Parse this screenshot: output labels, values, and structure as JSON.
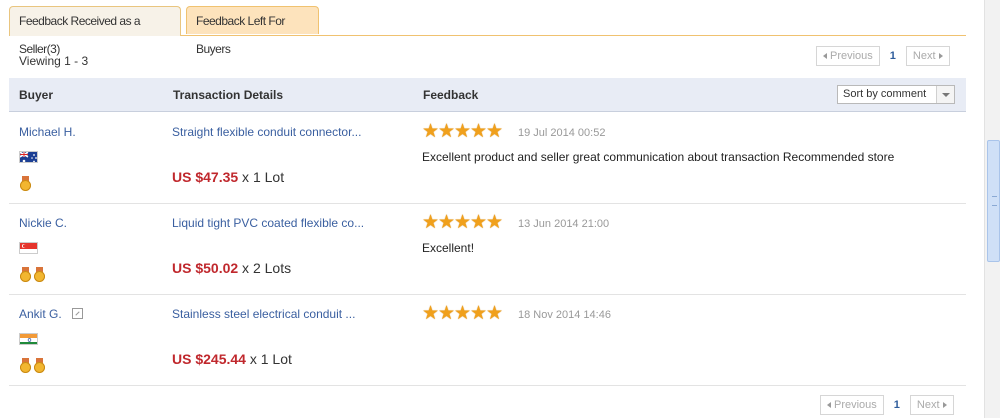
{
  "tabs": [
    {
      "label": "Feedback Received as a Seller(3)"
    },
    {
      "label": "Feedback Left For Buyers"
    }
  ],
  "viewing": "Viewing 1 - 3",
  "pagination": {
    "prev": "Previous",
    "page": "1",
    "next": "Next"
  },
  "table": {
    "headers": {
      "buyer": "Buyer",
      "transaction": "Transaction Details",
      "feedback": "Feedback"
    },
    "sort": {
      "selected": "Sort by comment"
    },
    "rows": [
      {
        "buyer": "Michael H.",
        "flag": "australia-flag",
        "medals": 1,
        "transaction": "Straight flexible conduit connector...",
        "price": "US $47.35",
        "qty": " x 1 Lot",
        "stars": 5,
        "date": "19 Jul 2014 00:52",
        "comment": "Excellent product and seller great communication about transaction Recommended store"
      },
      {
        "buyer": "Nickie C.",
        "flag": "singapore-flag",
        "medals": 2,
        "transaction": "Liquid tight PVC coated flexible co...",
        "price": "US $50.02",
        "qty": " x 2 Lots",
        "stars": 5,
        "date": "13 Jun 2014 21:00",
        "comment": "Excellent!"
      },
      {
        "buyer": "Ankit G.",
        "flag": "india-flag",
        "medals": 2,
        "transaction": "Stainless steel electrical conduit ...",
        "price": "US $245.44",
        "qty": " x 1 Lot",
        "stars": 5,
        "date": "18 Nov 2014 14:46",
        "comment": ""
      }
    ]
  },
  "colors": {
    "accent_tab_border": "#f0c270",
    "price": "#c0282d",
    "link": "#3a5fa0",
    "star": "#f0a01c"
  }
}
